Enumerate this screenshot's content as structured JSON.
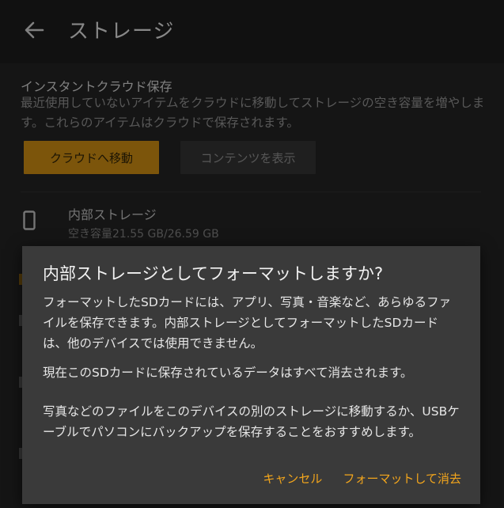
{
  "appbar": {
    "title": "ストレージ",
    "back_icon": "arrow-left-icon"
  },
  "cloud_section": {
    "title": "インスタントクラウド保存",
    "description": "最近使用していないアイテムをクラウドに移動してストレージの空き容量を増やします。これらのアイテムはクラウドで保存されます。",
    "move_button": "クラウドへ移動",
    "view_button": "コンテンツを表示"
  },
  "internal_storage": {
    "icon": "phone-icon",
    "title": "内部ストレージ",
    "subtitle": "空き容量21.55 GB/26.59 GB"
  },
  "dialog": {
    "title": "内部ストレージとしてフォーマットしますか?",
    "paragraph1": "フォーマットしたSDカードには、アプリ、写真・音楽など、あらゆるファイルを保存できます。内部ストレージとしてフォーマットしたSDカードは、他のデバイスでは使用できません。",
    "paragraph2": "現在このSDカードに保存されているデータはすべて消去されます。",
    "paragraph3": "写真などのファイルをこのデバイスの別のストレージに移動するか、USBケーブルでパソコンにバックアップを保存することをおすすめします。",
    "cancel_button": "キャンセル",
    "confirm_button": "フォーマットして消去"
  },
  "colors": {
    "accent": "#f2a51c",
    "primary_button": "#c98a12",
    "dialog_bg": "#3a3a3a",
    "screen_bg": "#222222"
  }
}
